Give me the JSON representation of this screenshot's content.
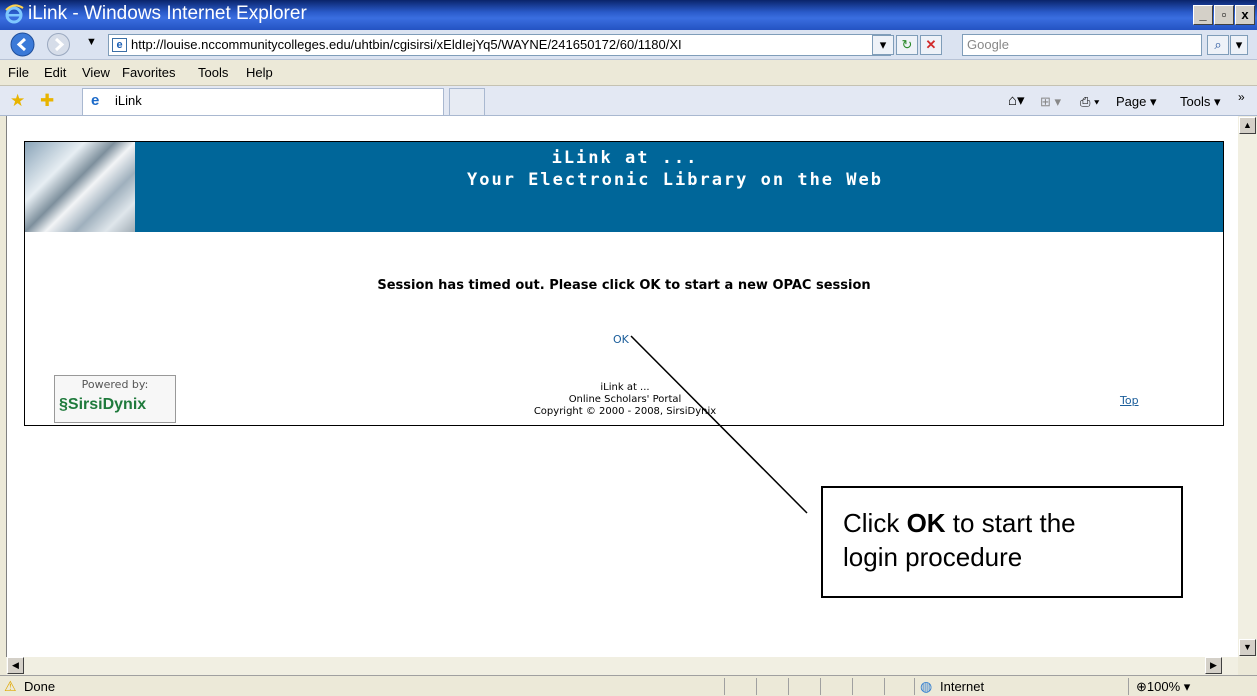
{
  "window": {
    "title": "iLink - Windows Internet Explorer",
    "min": "_",
    "max": "▫",
    "close": "x"
  },
  "address": {
    "url": "http://louise.nccommunitycolleges.edu/uhtbin/cgisirsi/xEldIejYq5/WAYNE/241650172/60/1180/XI",
    "search_placeholder": "Google"
  },
  "menu": [
    "File",
    "Edit",
    "View",
    "Favorites",
    "Tools",
    "Help"
  ],
  "tab": {
    "label": "iLink"
  },
  "command_bar": {
    "page": "Page",
    "tools": "Tools"
  },
  "page": {
    "header_line1": "iLink at ...",
    "header_line2": "Your Electronic Library on the Web",
    "message": "Session has timed out. Please click OK to start a new OPAC session",
    "ok_link": "OK",
    "powered_by": "Powered by:",
    "powered_logo": "SirsiDynix",
    "footer_line1": "iLink at ...",
    "footer_line2": "Online Scholars' Portal",
    "footer_line3": "Copyright © 2000 - 2008, SirsiDynix",
    "top_link": "Top"
  },
  "callout": {
    "prefix": "Click ",
    "bold": "OK",
    "suffix": " to start the",
    "line2": "login procedure"
  },
  "status": {
    "text": "Done",
    "zone": "Internet",
    "zoom": "100%"
  },
  "colors": {
    "header_bg": "#006699",
    "link": "#1a5d9a",
    "titlebar": "#2a5ac9"
  }
}
